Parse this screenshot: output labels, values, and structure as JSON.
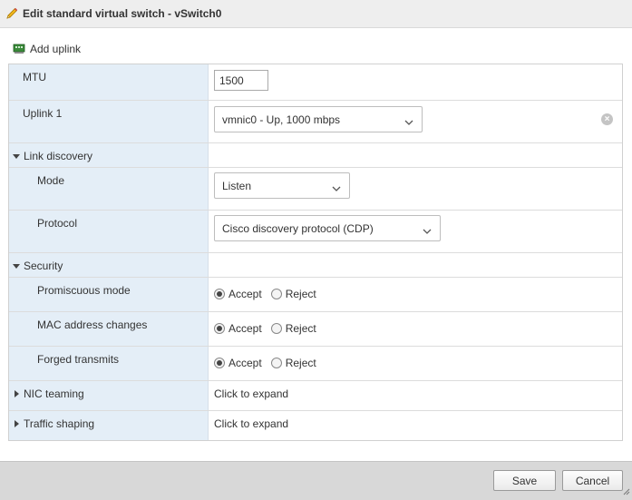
{
  "dialog": {
    "title": "Edit standard virtual switch - vSwitch0"
  },
  "toolbar": {
    "add_uplink_label": "Add uplink"
  },
  "form": {
    "mtu": {
      "label": "MTU",
      "value": "1500"
    },
    "uplink1": {
      "label": "Uplink 1",
      "selected": "vmnic0 - Up, 1000 mbps"
    },
    "link_discovery": {
      "section_label": "Link discovery",
      "mode": {
        "label": "Mode",
        "selected": "Listen"
      },
      "protocol": {
        "label": "Protocol",
        "selected": "Cisco discovery protocol (CDP)"
      }
    },
    "security": {
      "section_label": "Security",
      "accept_label": "Accept",
      "reject_label": "Reject",
      "promiscuous": {
        "label": "Promiscuous mode",
        "value": "Accept"
      },
      "mac_changes": {
        "label": "MAC address changes",
        "value": "Accept"
      },
      "forged": {
        "label": "Forged transmits",
        "value": "Accept"
      }
    },
    "nic_teaming": {
      "section_label": "NIC teaming",
      "expand_text": "Click to expand"
    },
    "traffic_shaping": {
      "section_label": "Traffic shaping",
      "expand_text": "Click to expand"
    }
  },
  "footer": {
    "save_label": "Save",
    "cancel_label": "Cancel"
  },
  "icons": {
    "title": "pencil-icon",
    "add_uplink": "network-card-add-icon",
    "clear": "close-circle-icon",
    "dropdown": "chevron-down-icon",
    "section_expanded": "caret-down-icon",
    "section_collapsed": "caret-right-icon",
    "resize": "resize-grip-icon"
  },
  "colors": {
    "label_column": "#e4eef7",
    "titlebar": "#eeeeee",
    "footer": "#d8d8d8",
    "pencil": "#e8a300"
  }
}
